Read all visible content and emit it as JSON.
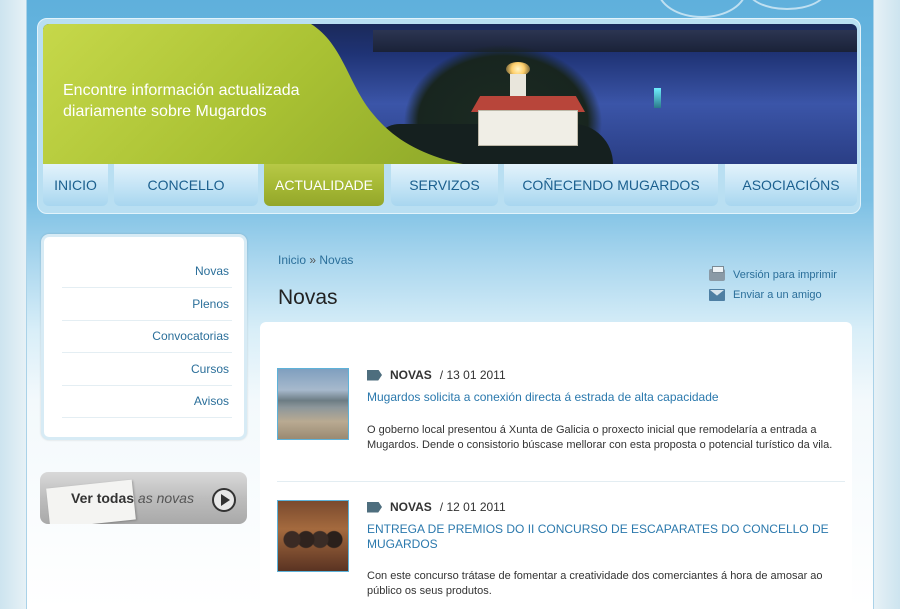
{
  "banner": {
    "line1": "Encontre información actualizada",
    "line2": "diariamente sobre Mugardos"
  },
  "nav": {
    "items": [
      {
        "label": "INICIO"
      },
      {
        "label": "CONCELLO"
      },
      {
        "label": "ACTUALIDADE",
        "active": true
      },
      {
        "label": "SERVIZOS"
      },
      {
        "label": "COÑECENDO MUGARDOS"
      },
      {
        "label": "ASOCIACIÓNS"
      }
    ]
  },
  "sidebar": {
    "items": [
      {
        "label": "Novas"
      },
      {
        "label": "Plenos"
      },
      {
        "label": "Convocatorias"
      },
      {
        "label": "Cursos"
      },
      {
        "label": "Avisos"
      }
    ],
    "ver_todas": {
      "bold": "Ver todas",
      "italic": "as novas"
    }
  },
  "breadcrumb": {
    "home": "Inicio",
    "separator": "»",
    "current": "Novas"
  },
  "page_title": "Novas",
  "tools": {
    "print": "Versión para imprimir",
    "email": "Enviar a un amigo"
  },
  "news": [
    {
      "category": "NOVAS",
      "date": "/ 13 01 2011",
      "title": "Mugardos solicita a conexión directa á estrada de alta capacidade",
      "summary": "O goberno local presentou á Xunta de Galicia o proxecto inicial que remodelaría a entrada a Mugardos. Dende o consistorio búscase mellorar con esta proposta o potencial turístico da vila."
    },
    {
      "category": "NOVAS",
      "date": "/ 12 01 2011",
      "title": "ENTREGA DE PREMIOS DO II CONCURSO DE ESCAPARATES DO CONCELLO DE MUGARDOS",
      "summary": "Con este concurso trátase de fomentar a creatividade dos comerciantes á hora de amosar ao público os seus produtos."
    }
  ],
  "colors": {
    "accent_green": "#a6b935",
    "link_blue": "#2b79ad",
    "nav_text": "#1b5f8e"
  }
}
